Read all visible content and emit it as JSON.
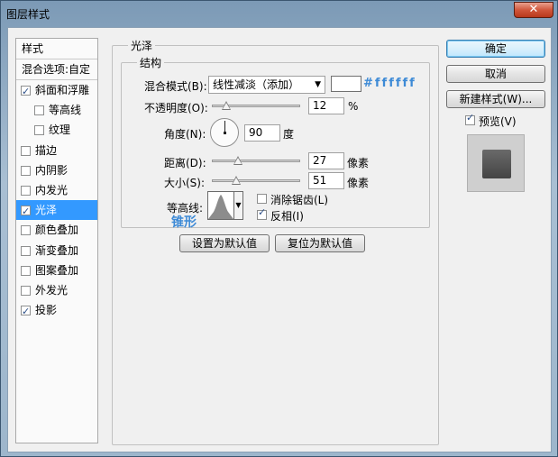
{
  "window": {
    "title": "图层样式",
    "close_glyph": "✕"
  },
  "left_list": {
    "header": "样式",
    "blend_options": "混合选项:自定",
    "items": [
      {
        "label": "斜面和浮雕",
        "checked": true,
        "sub": false
      },
      {
        "label": "等高线",
        "checked": false,
        "sub": true
      },
      {
        "label": "纹理",
        "checked": false,
        "sub": true
      },
      {
        "label": "描边",
        "checked": false,
        "sub": false
      },
      {
        "label": "内阴影",
        "checked": false,
        "sub": false
      },
      {
        "label": "内发光",
        "checked": false,
        "sub": false
      },
      {
        "label": "光泽",
        "checked": true,
        "sub": false,
        "selected": true
      },
      {
        "label": "颜色叠加",
        "checked": false,
        "sub": false
      },
      {
        "label": "渐变叠加",
        "checked": false,
        "sub": false
      },
      {
        "label": "图案叠加",
        "checked": false,
        "sub": false
      },
      {
        "label": "外发光",
        "checked": false,
        "sub": false
      },
      {
        "label": "投影",
        "checked": true,
        "sub": false
      }
    ]
  },
  "satin": {
    "group_title": "光泽",
    "structure_title": "结构",
    "blend_mode_label": "混合模式(B):",
    "blend_mode_value": "线性减淡（添加）",
    "color_hex_label": "#ffffff",
    "opacity_label": "不透明度(O):",
    "opacity_value": "12",
    "opacity_unit": "%",
    "opacity_fraction": 0.12,
    "angle_label": "角度(N):",
    "angle_value": "90",
    "angle_unit": "度",
    "distance_label": "距离(D):",
    "distance_value": "27",
    "distance_unit": "像素",
    "distance_fraction": 0.27,
    "size_label": "大小(S):",
    "size_value": "51",
    "size_unit": "像素",
    "size_fraction": 0.25,
    "contour_label": "等高线:",
    "contour_name": "锥形",
    "antialias_label": "消除锯齿(L)",
    "antialias_checked": false,
    "invert_label": "反相(I)",
    "invert_checked": true,
    "make_default": "设置为默认值",
    "reset_default": "复位为默认值"
  },
  "right": {
    "ok": "确定",
    "cancel": "取消",
    "new_style": "新建样式(W)...",
    "preview_label": "预览(V)",
    "preview_checked": true
  },
  "colors": {
    "accent": "#3d8ad6",
    "selection": "#3399ff",
    "swatch": "#ffffff"
  }
}
